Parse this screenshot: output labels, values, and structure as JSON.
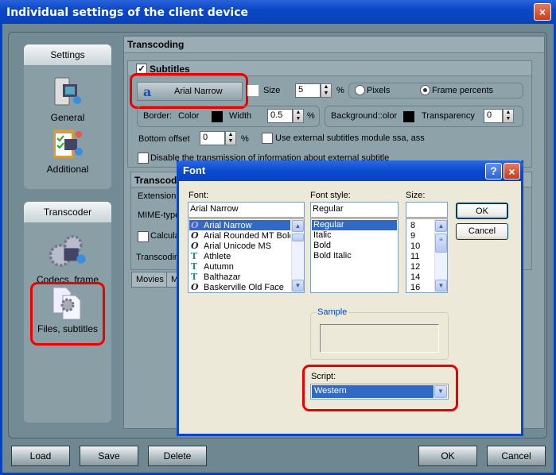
{
  "window": {
    "title": "Individual settings of the client device",
    "close": "×"
  },
  "sidebar": {
    "groups": [
      {
        "header": "Settings",
        "items": [
          {
            "label": "General",
            "icon": "media-server-icon"
          },
          {
            "label": "Additional",
            "icon": "clipboard-checklist-icon"
          }
        ]
      },
      {
        "header": "Transcoder",
        "items": [
          {
            "label": "Codecs, frame",
            "icon": "gears-film-icon"
          },
          {
            "label": "Files, subtitles",
            "icon": "files-gear-icon",
            "highlighted": true
          }
        ]
      }
    ]
  },
  "main": {
    "header": "Transcoding",
    "subtitles": {
      "checkbox_label": "Subtitles",
      "checked": true,
      "font_button": "Arial Narrow",
      "font_icon": "a",
      "size_label": "Size",
      "size_value": "5",
      "percent": "%",
      "units": [
        {
          "label": "Pixels",
          "selected": false
        },
        {
          "label": "Frame percents",
          "selected": true
        }
      ],
      "border_label": "Border:",
      "color_label": "Color",
      "width_label": "Width",
      "width_value": "0.5",
      "background_label": "Background::olor",
      "transparency_label": "Transparency",
      "transparency_value": "0",
      "bottom_offset_label": "Bottom offset",
      "bottom_offset_value": "0",
      "external_module_label": "Use external subtitles module ssa, ass",
      "disable_transmission_label": "Disable the transmission of information about external subtitles"
    },
    "transcoding2": {
      "header": "Transcodi",
      "extension_label": "Extension",
      "mime_label": "MIME-type",
      "calc_label": "Calcula",
      "transcoding_label": "Transcodin"
    },
    "tabs": [
      "Movies",
      "M"
    ]
  },
  "font_dialog": {
    "title": "Font",
    "help": "?",
    "close": "×",
    "font_label": "Font:",
    "font_value": "Arial Narrow",
    "fonts": [
      {
        "name": "Arial Narrow",
        "type": "opentype",
        "selected": true
      },
      {
        "name": "Arial Rounded MT Bold",
        "type": "opentype"
      },
      {
        "name": "Arial Unicode MS",
        "type": "opentype"
      },
      {
        "name": "Athlete",
        "type": "truetype"
      },
      {
        "name": "Autumn",
        "type": "truetype"
      },
      {
        "name": "Balthazar",
        "type": "truetype"
      },
      {
        "name": "Baskerville Old Face",
        "type": "opentype"
      }
    ],
    "style_label": "Font style:",
    "style_value": "Regular",
    "styles": [
      "Regular",
      "Italic",
      "Bold",
      "Bold Italic"
    ],
    "size_label": "Size:",
    "size_value": "",
    "sizes": [
      "8",
      "9",
      "10",
      "11",
      "12",
      "14",
      "16"
    ],
    "ok": "OK",
    "cancel": "Cancel",
    "sample_label": "Sample",
    "script_label": "Script:",
    "script_value": "Western"
  },
  "footer": {
    "load": "Load",
    "save": "Save",
    "delete": "Delete",
    "ok": "OK",
    "cancel": "Cancel"
  },
  "colors": {
    "highlight": "#e00000",
    "selection": "#316ac5",
    "title_blue": "#0a48c8"
  }
}
